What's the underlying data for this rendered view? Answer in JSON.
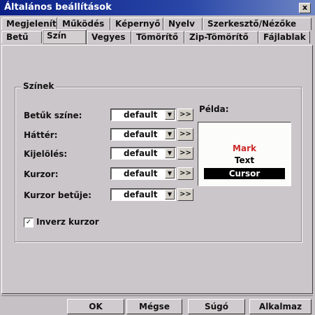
{
  "window": {
    "title": "Általános beállítások",
    "close_glyph": "x"
  },
  "tabs_row1": [
    "Megjelenítés",
    "Működés",
    "Képernyő",
    "Nyelv",
    "Szerkesztő/Nézőke"
  ],
  "tabs_row2": [
    "Betű",
    "Szín",
    "Vegyes",
    "Tömörítő",
    "Zip-Tömörítő",
    "Fájlablak"
  ],
  "active_tab": "Szín",
  "group": {
    "title": "Színek"
  },
  "fields": [
    {
      "label": "Betűk színe:",
      "value": "default",
      "more": ">>"
    },
    {
      "label": "Háttér:",
      "value": "default",
      "more": ">>"
    },
    {
      "label": "Kijelölés:",
      "value": "default",
      "more": ">>"
    },
    {
      "label": "Kurzor:",
      "value": "default",
      "more": ">>"
    },
    {
      "label": "Kurzor betűje:",
      "value": "default",
      "more": ">>"
    }
  ],
  "preview": {
    "label": "Példa:",
    "mark": "Mark",
    "text": "Text",
    "cursor": "Cursor",
    "colors": {
      "mark": "#cc2a2a",
      "text": "#000000",
      "cursor_bg": "#000000",
      "cursor_fg": "#ffffff",
      "bg": "#fcfcfa"
    }
  },
  "inverse_cursor": {
    "label": "Inverz kurzor",
    "checked": true,
    "mark": "✓"
  },
  "buttons": {
    "ok": "OK",
    "cancel": "Mégse",
    "help": "Súgó",
    "apply": "Alkalmaz"
  },
  "colors": {
    "title_bar": "#0a1f86",
    "dialog_bg": "#c6c1c4"
  }
}
